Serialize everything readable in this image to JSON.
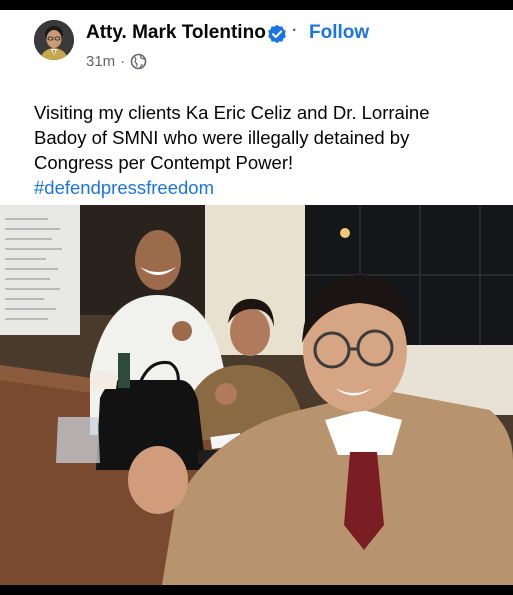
{
  "post": {
    "author": "Atty. Mark Tolentino",
    "separator": "·",
    "follow_label": "Follow",
    "time": "31m",
    "meta_separator": "·",
    "privacy_icon": "globe-icon",
    "verified_icon": "verified-badge-icon",
    "text": "Visiting my clients Ka Eric Celiz and Dr. Lorraine Badoy of SMNI who were illegally detained by Congress per Contempt Power!",
    "hashtag": "#defendpressfreedom"
  },
  "colors": {
    "link": "#1b74e4",
    "verified": "#1b74e4",
    "text": "#050505",
    "secondary": "#65676b"
  }
}
